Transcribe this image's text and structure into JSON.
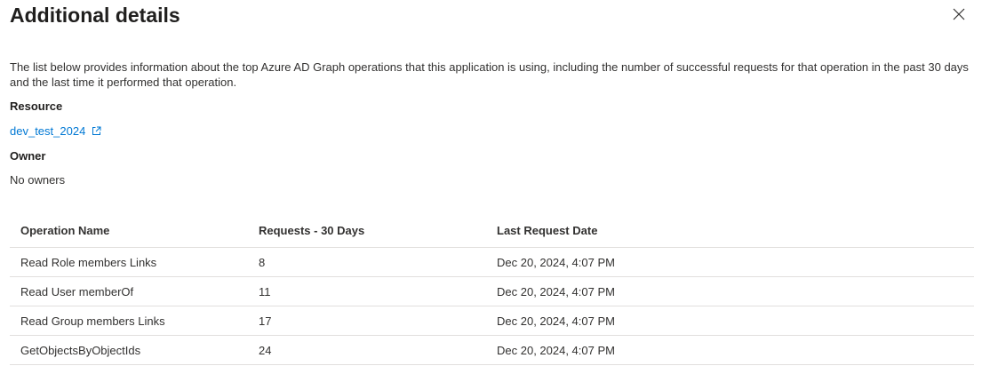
{
  "panel": {
    "title": "Additional details",
    "close_icon": "close-icon"
  },
  "description": "The list below provides information about the top Azure AD Graph operations that this application is using, including the number of successful requests for that operation in the past 30 days and the last time it performed that operation.",
  "resource": {
    "label": "Resource",
    "link_text": "dev_test_2024",
    "link_icon": "external-link-icon"
  },
  "owner": {
    "label": "Owner",
    "value": "No owners"
  },
  "table": {
    "headers": [
      "Operation Name",
      "Requests - 30 Days",
      "Last Request Date"
    ],
    "rows": [
      {
        "operation": "Read Role members Links",
        "requests": "8",
        "last_request": "Dec 20, 2024, 4:07 PM"
      },
      {
        "operation": "Read User memberOf",
        "requests": "11",
        "last_request": "Dec 20, 2024, 4:07 PM"
      },
      {
        "operation": "Read Group members Links",
        "requests": "17",
        "last_request": "Dec 20, 2024, 4:07 PM"
      },
      {
        "operation": "GetObjectsByObjectIds",
        "requests": "24",
        "last_request": "Dec 20, 2024, 4:07 PM"
      }
    ]
  },
  "colors": {
    "link": "#0078d4",
    "text": "#323130",
    "divider": "#e1dfdd"
  }
}
